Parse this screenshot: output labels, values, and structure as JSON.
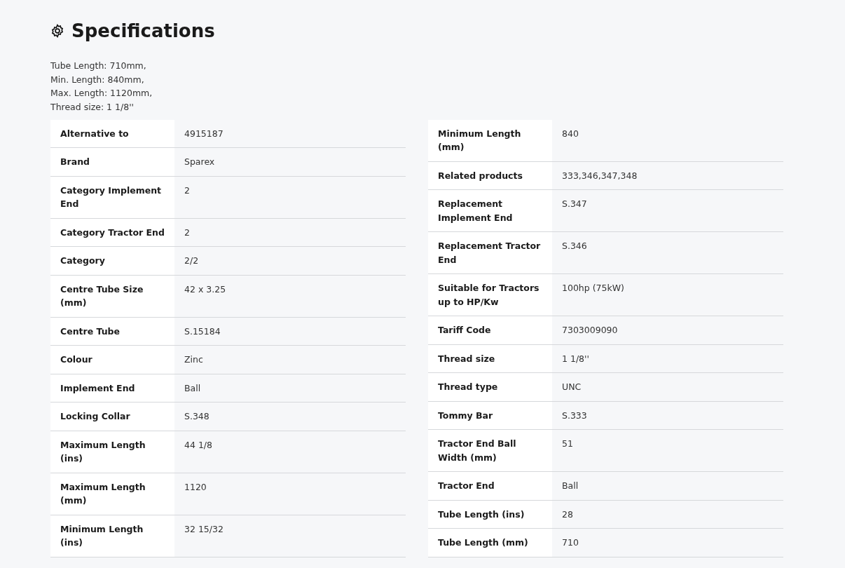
{
  "title": "Specifications",
  "description": [
    "Tube Length: 710mm,",
    "Min. Length: 840mm,",
    "Max. Length: 1120mm,",
    "Thread size: 1 1/8''"
  ],
  "tables": [
    {
      "rows": [
        {
          "label": "Alternative to",
          "value": "4915187"
        },
        {
          "label": "Brand",
          "value": "Sparex"
        },
        {
          "label": "Category Implement End",
          "value": "2"
        },
        {
          "label": "Category Tractor End",
          "value": "2"
        },
        {
          "label": "Category",
          "value": "2/2"
        },
        {
          "label": "Centre Tube Size (mm)",
          "value": "42 x 3.25"
        },
        {
          "label": "Centre Tube",
          "value": "S.15184"
        },
        {
          "label": "Colour",
          "value": "Zinc"
        },
        {
          "label": "Implement End",
          "value": "Ball"
        },
        {
          "label": "Locking Collar",
          "value": "S.348"
        },
        {
          "label": "Maximum Length (ins)",
          "value": "44 1/8"
        },
        {
          "label": "Maximum Length (mm)",
          "value": "1120"
        },
        {
          "label": "Minimum Length (ins)",
          "value": "32 15/32"
        }
      ]
    },
    {
      "rows": [
        {
          "label": "Minimum Length (mm)",
          "value": "840"
        },
        {
          "label": "Related products",
          "value": "333,346,347,348"
        },
        {
          "label": "Replacement Implement End",
          "value": "S.347"
        },
        {
          "label": "Replacement Tractor End",
          "value": "S.346"
        },
        {
          "label": "Suitable for Tractors up to HP/Kw",
          "value": "100hp (75kW)"
        },
        {
          "label": "Tariff Code",
          "value": "7303009090"
        },
        {
          "label": "Thread size",
          "value": "1 1/8''"
        },
        {
          "label": "Thread type",
          "value": "UNC"
        },
        {
          "label": "Tommy Bar",
          "value": "S.333"
        },
        {
          "label": "Tractor End Ball Width (mm)",
          "value": "51"
        },
        {
          "label": "Tractor End",
          "value": "Ball"
        },
        {
          "label": "Tube Length (ins)",
          "value": "28"
        },
        {
          "label": "Tube Length (mm)",
          "value": "710"
        }
      ]
    }
  ]
}
